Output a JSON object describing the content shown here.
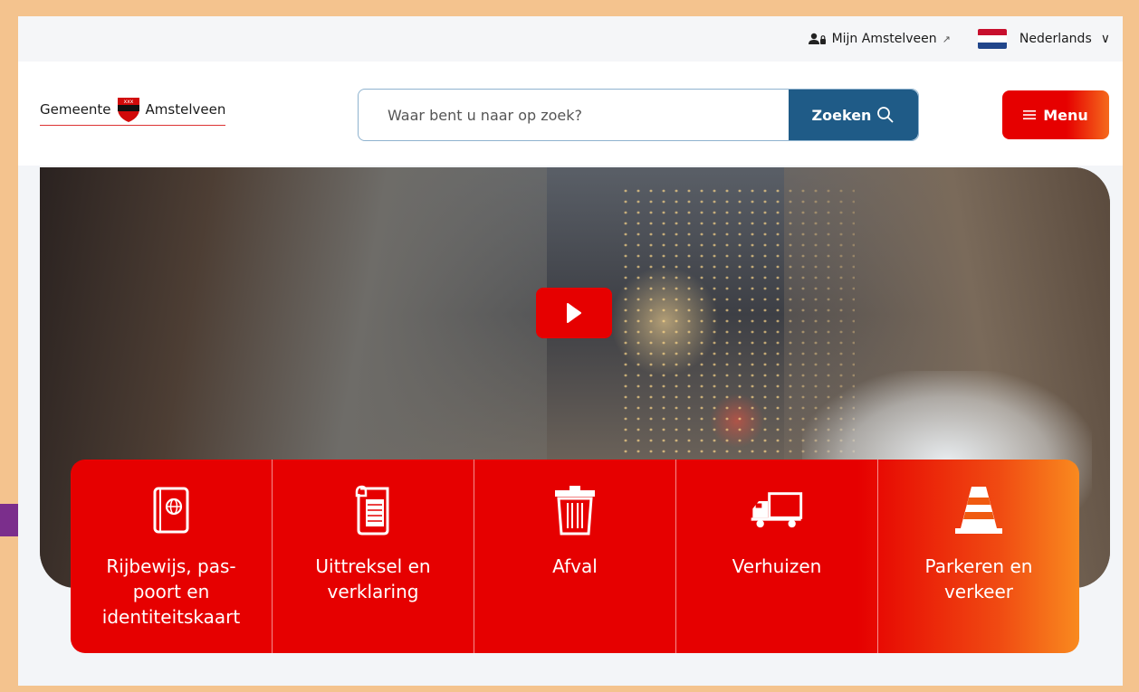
{
  "topbar": {
    "account_label": "Mijn Amstelveen",
    "language_label": "Nederlands"
  },
  "header": {
    "logo_left": "Gemeente",
    "logo_right": "Amstelveen",
    "search_placeholder": "Waar bent u naar op zoek?",
    "search_button": "Zoeken",
    "menu_button": "Menu"
  },
  "quick_links": [
    {
      "label": "Rijbewijs, pas-poort en identiteitskaart",
      "icon": "passport-icon"
    },
    {
      "label": "Uittreksel en verklaring",
      "icon": "document-icon"
    },
    {
      "label": "Afval",
      "icon": "trash-icon"
    },
    {
      "label": "Verhuizen",
      "icon": "moving-truck-icon"
    },
    {
      "label": "Parkeren en verkeer",
      "icon": "traffic-cone-icon"
    }
  ],
  "colors": {
    "brand_red": "#e60000",
    "search_blue": "#1f5b87",
    "frame_orange": "#f4c38e",
    "arrow_purple": "#7b2e8c"
  }
}
